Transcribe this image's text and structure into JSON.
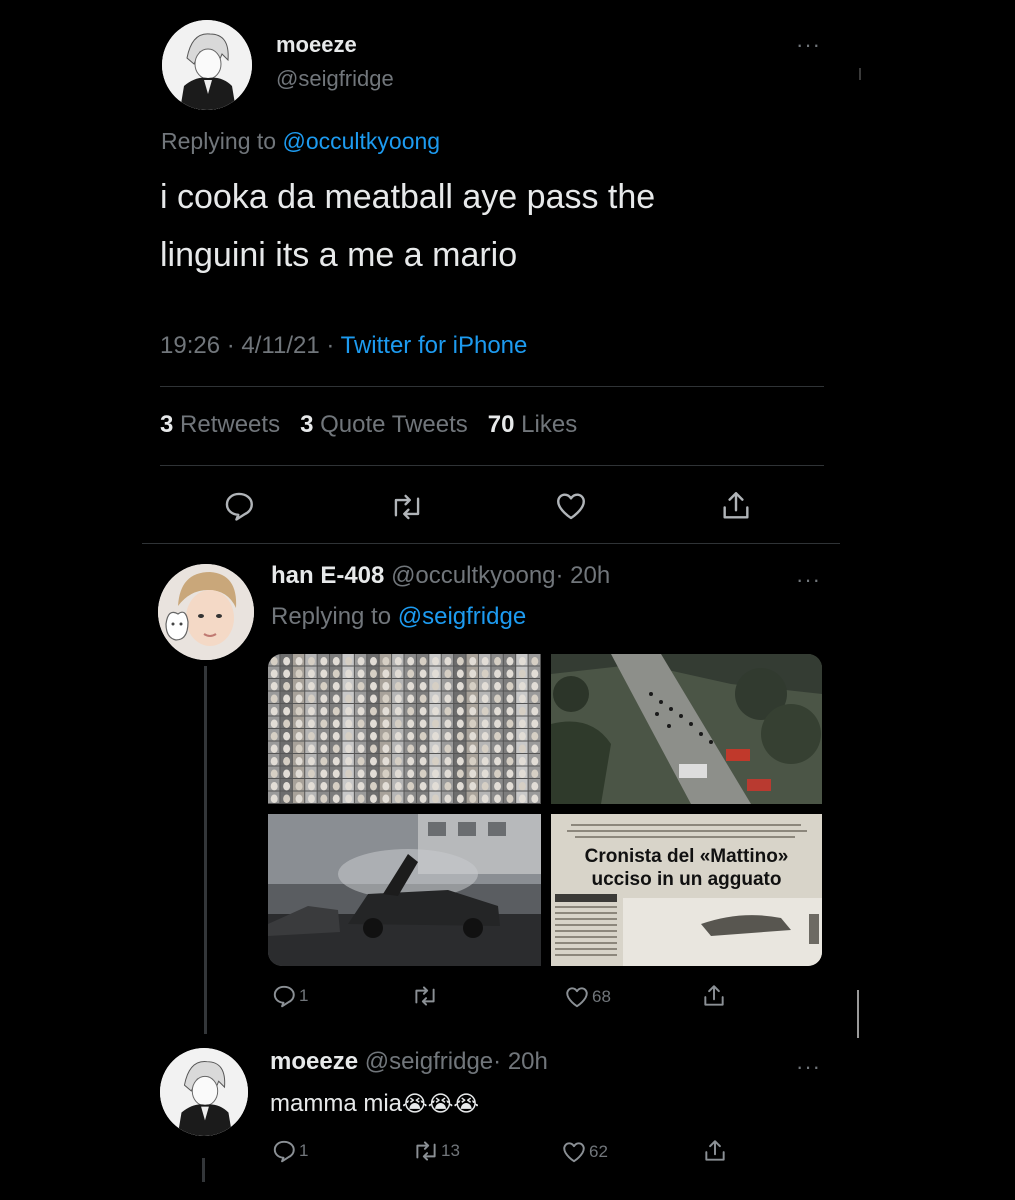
{
  "main_tweet": {
    "display_name": "moeeze",
    "handle": "@seigfridge",
    "replying_prefix": "Replying to",
    "replying_handle": "@occultkyoong",
    "text_line1": "i cooka da meatball aye pass the",
    "text_line2": "linguini its a me a mario",
    "time": "19:26",
    "date": "4/11/21",
    "sep": "·",
    "source": "Twitter for iPhone",
    "retweets_count": "3",
    "retweets_label": "Retweets",
    "quotes_count": "3",
    "quotes_label": "Quote Tweets",
    "likes_count": "70",
    "likes_label": "Likes"
  },
  "reply1": {
    "display_name": "han E-408",
    "handle": "@occultkyoong",
    "time": "· 20h",
    "replying_prefix": "Replying to",
    "replying_handle": "@seigfridge",
    "headline_line1": "Cronista del «Mattino»",
    "headline_line2": "ucciso in un agguato",
    "reply_count": "1",
    "like_count": "68"
  },
  "reply2": {
    "display_name": "moeeze",
    "handle": "@seigfridge",
    "time": "· 20h",
    "text": "mamma mia",
    "emoji": "😭😭😭",
    "reply_count": "1",
    "retweet_count": "13",
    "like_count": "62"
  },
  "ui": {
    "more_glyph": "···"
  }
}
